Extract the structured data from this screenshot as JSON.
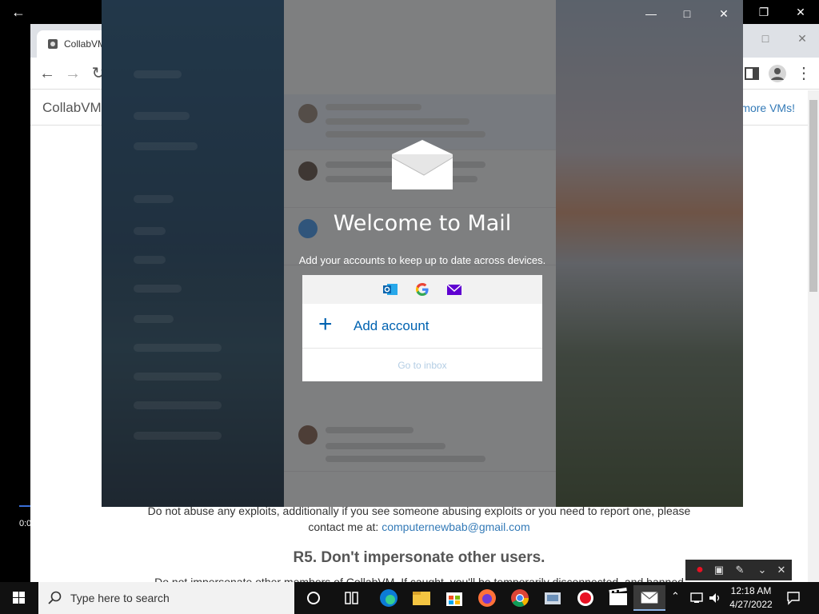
{
  "browser": {
    "tab_title": "CollabVM",
    "page_brand": "CollabVM",
    "more_vms_link": "more VMs!"
  },
  "page": {
    "rule_text_line1": "Do not abuse any exploits, additionally if you see someone abusing exploits or you need to report one, please",
    "rule_text_line2_prefix": "contact me at: ",
    "contact_email": "computernewbab@gmail.com",
    "rule_heading": "R5. Don't impersonate other users.",
    "rule_text_cut": "Do not impersonate other members of CollabVM. If caught, you'll be temporarily disconnected, and banned"
  },
  "player": {
    "time_label": "0:0"
  },
  "mail_dialog": {
    "title": "Welcome to Mail",
    "subtitle": "Add your accounts to keep up to date across devices.",
    "add_account_label": "Add account",
    "go_to_inbox_label": "Go to inbox",
    "providers": [
      "outlook-icon",
      "google-icon",
      "yahoo-mail-icon"
    ]
  },
  "taskbar": {
    "search_placeholder": "Type here to search",
    "clock_time": "12:18 AM",
    "clock_date": "4/27/2022",
    "accent_color": "#8fb6e8"
  }
}
